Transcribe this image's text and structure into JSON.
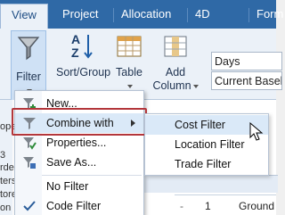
{
  "tabs": [
    {
      "label": "View",
      "active": true
    },
    {
      "label": "Project"
    },
    {
      "label": "Allocation"
    },
    {
      "label": "4D"
    },
    {
      "label": "Form"
    }
  ],
  "ribbon": {
    "filter": {
      "label": "Filter",
      "icon": "funnel-icon"
    },
    "sort_group": {
      "label": "Sort/Group",
      "icon": "sort-az-icon"
    },
    "table": {
      "label": "Table",
      "icon": "table-icon"
    },
    "add_column": {
      "label1": "Add",
      "label2": "Column",
      "icon": "add-column-icon"
    },
    "days_field": "Days",
    "baseline_field": "Current Basel"
  },
  "background": {
    "left_fragments": [
      "ope",
      "3",
      "rde",
      "ters",
      "tore",
      "on"
    ],
    "grid_row_num": "1",
    "grid_row_text": "Ground"
  },
  "filter_menu": {
    "items": [
      {
        "label": "New...",
        "icon": "funnel-plus-icon"
      },
      {
        "label": "Combine with",
        "icon": "funnel-icon",
        "has_submenu": true
      },
      {
        "label": "Properties...",
        "icon": "funnel-check-icon"
      },
      {
        "label": "Save As...",
        "icon": "funnel-save-icon"
      },
      {
        "label": "No Filter"
      },
      {
        "label": "Code Filter",
        "icon": "checkmark-icon"
      }
    ]
  },
  "combine_submenu": {
    "items": [
      {
        "label": "Cost Filter"
      },
      {
        "label": "Location Filter"
      },
      {
        "label": "Trade Filter"
      }
    ]
  },
  "colors": {
    "tab_bar": "#2f69a6",
    "highlight_border": "#b3363b",
    "menu_highlight": "#dae9f8"
  }
}
